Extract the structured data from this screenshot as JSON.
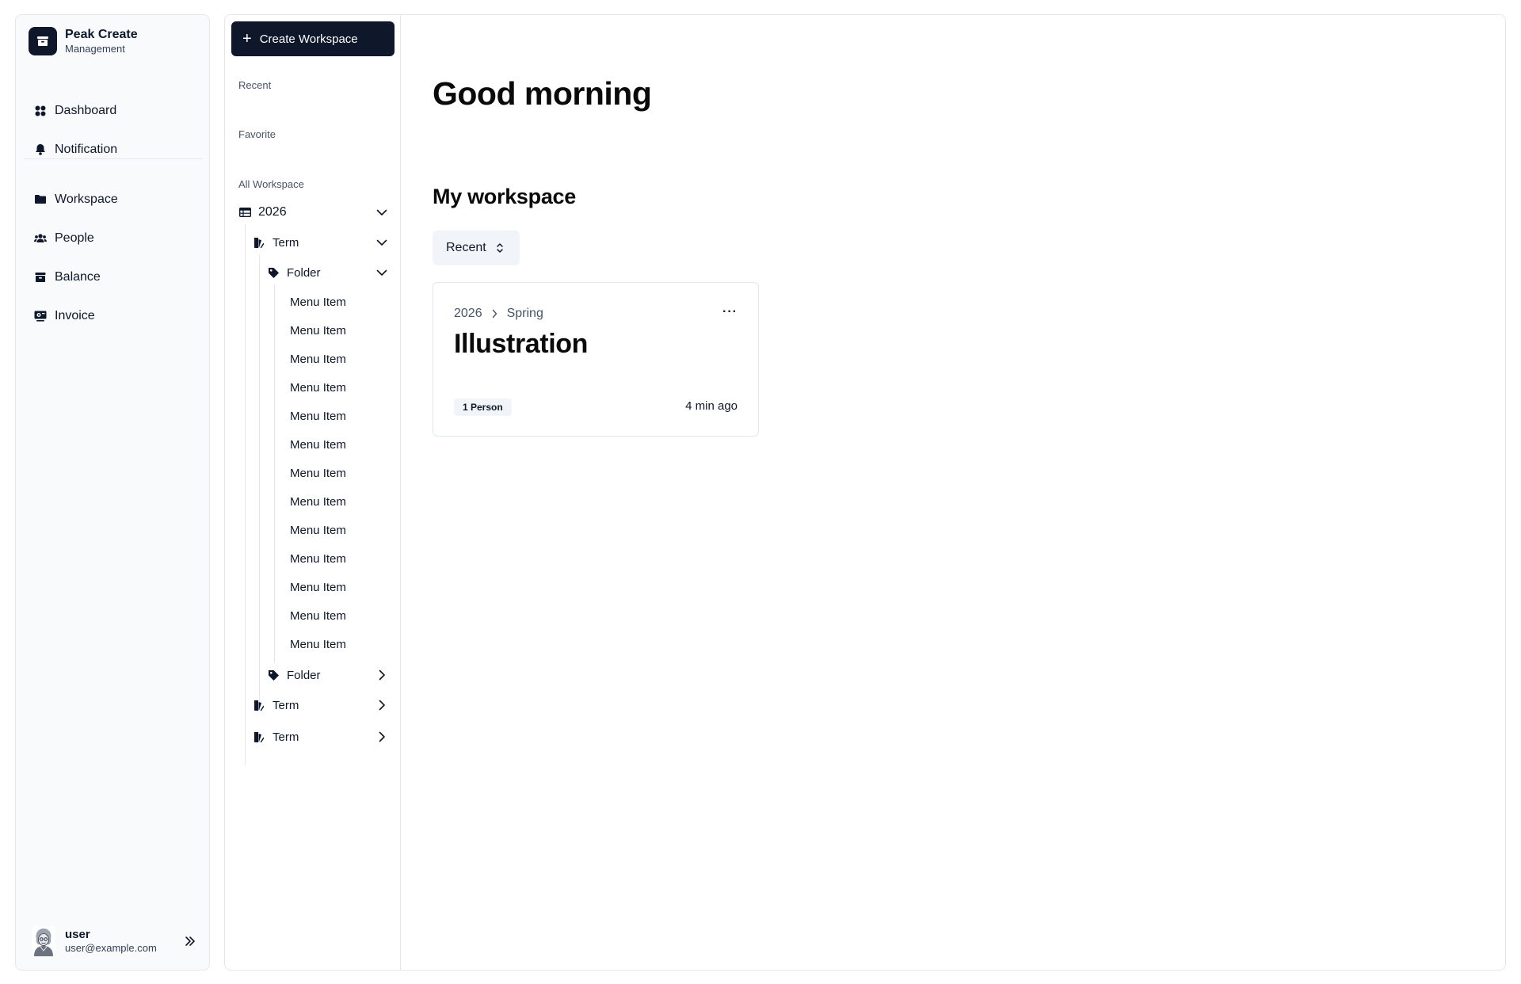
{
  "brand": {
    "title": "Peak Create",
    "subtitle": "Management"
  },
  "nav": {
    "top": [
      {
        "label": "Dashboard",
        "icon": "dashboard-icon"
      },
      {
        "label": "Notification",
        "icon": "bell-icon"
      }
    ],
    "bottom": [
      {
        "label": "Workspace",
        "icon": "folder-icon"
      },
      {
        "label": "People",
        "icon": "people-icon"
      },
      {
        "label": "Balance",
        "icon": "wallet-icon"
      },
      {
        "label": "Invoice",
        "icon": "invoice-icon"
      }
    ]
  },
  "user": {
    "name": "user",
    "email": "user@example.com"
  },
  "tree": {
    "create_label": "Create Workspace",
    "sections": {
      "recent": "Recent",
      "favorite": "Favorite",
      "all": "All Workspace"
    },
    "year": "2026",
    "term_label": "Term",
    "folder_label": "Folder",
    "menu_items": [
      "Menu Item",
      "Menu Item",
      "Menu Item",
      "Menu Item",
      "Menu Item",
      "Menu Item",
      "Menu Item",
      "Menu Item",
      "Menu Item",
      "Menu Item",
      "Menu Item",
      "Menu Item",
      "Menu Item"
    ]
  },
  "main": {
    "greeting": "Good morning",
    "section_title": "My workspace",
    "sort_label": "Recent",
    "card": {
      "crumb_year": "2026",
      "crumb_term": "Spring",
      "more": "···",
      "title": "Illustration",
      "badge": "1 Person",
      "time": "4 min ago"
    }
  },
  "colors": {
    "primary": "#0f172a",
    "muted_bg": "#f1f5f9",
    "border": "#e5e7eb",
    "sidebar_bg": "#f8fafc"
  }
}
